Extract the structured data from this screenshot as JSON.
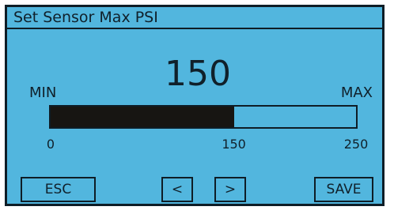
{
  "screen": {
    "title": "Set Sensor Max PSI",
    "current_value": "150",
    "value_number": 150,
    "min_label": "MIN",
    "max_label": "MAX",
    "range_min": 0,
    "range_max": 250,
    "ticks": [
      "0",
      "150",
      "250"
    ]
  },
  "buttons": {
    "esc": "ESC",
    "prev": "<",
    "next": ">",
    "save": "SAVE"
  },
  "colors": {
    "background": "#52b6de",
    "bar_fill": "#171512",
    "border": "#0e1d26"
  }
}
